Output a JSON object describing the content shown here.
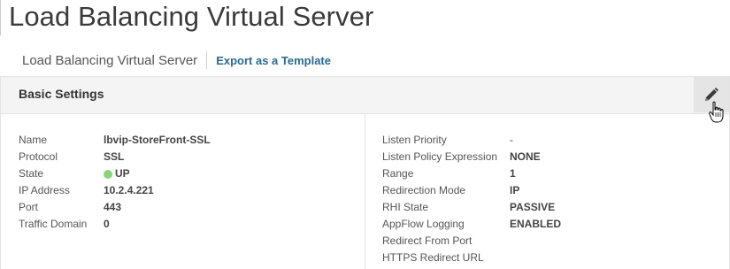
{
  "page": {
    "title": "Load Balancing Virtual Server"
  },
  "breadcrumb": {
    "title": "Load Balancing Virtual Server",
    "action_link": "Export as a Template"
  },
  "panel": {
    "title": "Basic Settings",
    "edit_icon": "pencil-icon",
    "left": [
      {
        "label": "Name",
        "value": "lbvip-StoreFront-SSL"
      },
      {
        "label": "Protocol",
        "value": "SSL"
      },
      {
        "label": "State",
        "value": "UP",
        "status_color": "#8bd47a"
      },
      {
        "label": "IP Address",
        "value": "10.2.4.221"
      },
      {
        "label": "Port",
        "value": "443"
      },
      {
        "label": "Traffic Domain",
        "value": "0"
      }
    ],
    "right": [
      {
        "label": "Listen Priority",
        "value": "-"
      },
      {
        "label": "Listen Policy Expression",
        "value": "NONE"
      },
      {
        "label": "Range",
        "value": "1"
      },
      {
        "label": "Redirection Mode",
        "value": "IP"
      },
      {
        "label": "RHI State",
        "value": "PASSIVE"
      },
      {
        "label": "AppFlow Logging",
        "value": "ENABLED"
      },
      {
        "label": "Redirect From Port",
        "value": ""
      },
      {
        "label": "HTTPS Redirect URL",
        "value": ""
      }
    ]
  },
  "colors": {
    "link": "#2b6a8f",
    "status_up": "#8bd47a",
    "header_bg": "#f4f4f4"
  }
}
